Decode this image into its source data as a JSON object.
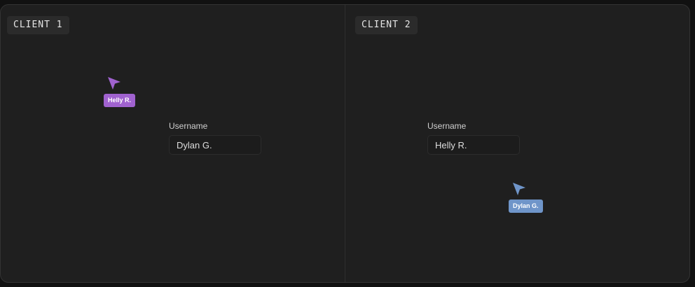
{
  "client1": {
    "tag": "CLIENT 1",
    "username_label": "Username",
    "username_value": "Dylan G.",
    "remote_cursor": {
      "name": "Helly R.",
      "color": "#a062cf",
      "icon": "cursor-arrow-icon"
    }
  },
  "client2": {
    "tag": "CLIENT 2",
    "username_label": "Username",
    "username_value": "Helly R.",
    "remote_cursor": {
      "name": "Dylan G.",
      "color": "#6f95c9",
      "icon": "cursor-arrow-icon"
    }
  }
}
